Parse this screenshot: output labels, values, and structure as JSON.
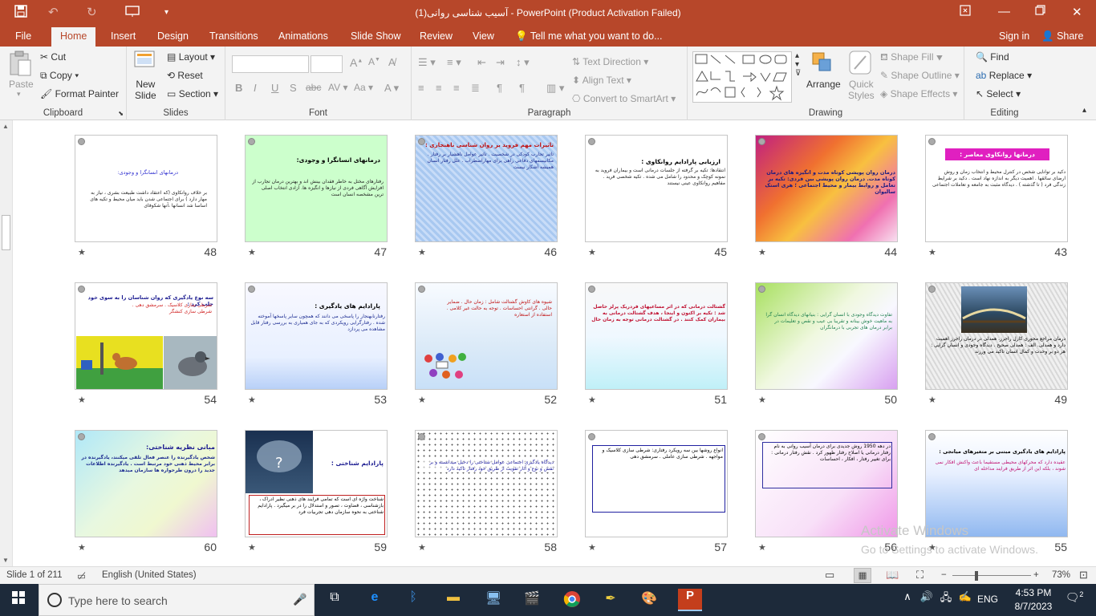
{
  "window": {
    "title": "آسیب شناسی روانی(1) - PowerPoint (Product Activation Failed)",
    "controls": [
      "restore-ribbon-icon",
      "minimize-icon",
      "maximize-icon",
      "close-icon"
    ]
  },
  "tabs": [
    "File",
    "Home",
    "Insert",
    "Design",
    "Transitions",
    "Animations",
    "Slide Show",
    "Review",
    "View"
  ],
  "active_tab": "Home",
  "tell_me": "Tell me what you want to do...",
  "account": {
    "signin": "Sign in",
    "share": "Share"
  },
  "ribbon": {
    "clipboard": {
      "label": "Clipboard",
      "paste": "Paste",
      "cut": "Cut",
      "copy": "Copy",
      "format_painter": "Format Painter"
    },
    "slides": {
      "label": "Slides",
      "new_slide": "New\nSlide",
      "layout": "Layout",
      "reset": "Reset",
      "section": "Section"
    },
    "font": {
      "label": "Font"
    },
    "paragraph": {
      "label": "Paragraph",
      "text_direction": "Text Direction",
      "align_text": "Align Text",
      "convert_smartart": "Convert to SmartArt"
    },
    "drawing": {
      "label": "Drawing",
      "arrange": "Arrange",
      "quick_styles": "Quick\nStyles",
      "shape_fill": "Shape Fill",
      "shape_outline": "Shape Outline",
      "shape_effects": "Shape Effects"
    },
    "editing": {
      "label": "Editing",
      "find": "Find",
      "replace": "Replace",
      "select": "Select"
    }
  },
  "slides": [
    {
      "n": "43",
      "heading": "درمانها روانکاوی معاصر :",
      "body": "دکید بر توانایی شخص در کنترل محیط و انتخاب زمان و روش ارضای سائقها . اهمیت دیگر به اندازه نهاد است . دکید بر شرایط زندگی فرد ( تا گذشته ) . دیدگاه مثبت به جامعه و تعاملات اجتماعی"
    },
    {
      "n": "44",
      "heading": "",
      "body": "درمان روان پویشی کوتاه مدت و انگیزه های درمان کوتاه مدت. درمان روان پویشی بین فردی: تکیه بر تعامل و روابط بیمار و محیط اجتماعی ؛ هری استک سالیوان"
    },
    {
      "n": "45",
      "heading": "ارزیابی پارادایم روانکاوی :",
      "body": "انتقادها: تکیه بر گرفته از جلسات درمانی است و بیماران فروید به نمونه کوچک و محدود را شامل می شده . تکیه شخصی فرید . مفاهیم روانکاوی عینی نیستند"
    },
    {
      "n": "46",
      "heading": "تاثیرات مهم فروید بر روان شناسی ناهنجاری :",
      "body": "تاثیر تجارب کودکی در شخصیت . تاثیر عوامل ناهشیار بر رفتار . مکانیسمهای دفاعی راهی برای مهاراضطراب . علل رفتار انسان همیشه آشکار نیست"
    },
    {
      "n": "47",
      "heading": "درمانهای انسانگرا و وجودی:",
      "body": "رفتارهای مختل به خاطر فقدان بینش اند و بهترین درمان تجارب از افزایش آگاهی فردی از نیازها و انگیزه ها. آزادی انتخاب اصلی ترین مشخصه انسان است"
    },
    {
      "n": "48",
      "heading": "درمانهای انسانگرا و وجودی:",
      "body": "بر خلاف روانکاوی (که اعتقاد داشت طبیعت بشری ، نیاز به مهار دارد ) برای اجتماعی شدن باید میان محیط و تکیه های اساسا شد انسانها ،آنها شکوفای"
    },
    {
      "n": "49",
      "heading": "",
      "body": "درمان مراجع محوری کارل راجرز. همدلی در درمان راجرز اهمیت دارد و همدلی. الف : همدلی صحیح . دیدگاه وجودی و انسان گرایی : هر دو بر وحدت و کمال انسان تاکید می ورزند"
    },
    {
      "n": "50",
      "heading": "",
      "body": "تفاوت دیدگاه وجودی با انسان گرایی : بنیانهای دیدگاه انسان گرا به ماهیت خوش بینانه و تقریبا بی عیب و نقص و تعلیمات در برابر درمان های تجربی با درمانگران"
    },
    {
      "n": "51",
      "heading": "",
      "body": "گشتالت درمانی که در اثر مساعیهای فردریک پرلز حاصل شد : تکیه بر اکنون و اینجا ، هدف گشتالت درمانی به بیماران کمک کنند . در گشتالت درمانی توجه به زمان حال"
    },
    {
      "n": "52",
      "heading": "",
      "body": "شیوه های کاوش گشتالت شامل : زمان حال . ضمایر حالی . گرانتی احساسات . توجه به حالت غیر کلامی . استفاده از استعاره"
    },
    {
      "n": "53",
      "heading": "پارادایم های یادگیری :",
      "body": "رفتارنابهنجار را پاسخی می دانند که همچون سایر پاسخها آموخته شده . رفتارگرایی رویکردی که به جای همیاری به بررسی رفتار قابل مشاهده می پردازد"
    },
    {
      "n": "54",
      "heading": "سه نوع یادگیری که روان شناسان را به سوی خود جلب کرد :",
      "body": "شرطی سازی کلاسیک . سرمشق دهی . شرطی سازی کنشگر"
    },
    {
      "n": "55",
      "heading": "پارادایم های یادگیری مبتنی بر متغیرهای میانجی :",
      "body": "عقیده دارد که محرکهای محیطی مستقیما باعث واکنش افکار نمی شوند ، بلکه این اثر از طریق فرایند مداخله ای"
    },
    {
      "n": "56",
      "heading": "",
      "body": "در دهه 1950 روش جدیدی برای درمان آسیب روانی به نام رفتار درمانی یا اصلاح رفتار ظهور کرد . نقش رفتار درمانی : برای تغییر رفتار ، افکار ، احساسات"
    },
    {
      "n": "57",
      "heading": "",
      "body": "انواع روشها بین سه رویکرد رفتاری: شرطی سازی کلاسیک و مواجهه . شرطی سازی عاملی . سرمشق دهی"
    },
    {
      "n": "58",
      "heading": "",
      "body": "دیدگاه یادگیری اجتماعی عوامل شناختی را دخیل میدانسته و بر نقش و نوع و آثار تقویت از طریق خود رفتار تاکید دارد"
    },
    {
      "n": "59",
      "heading": "پارادایم شناختی :",
      "body": "شناخت واژه ای است که تمامی فرایند های ذهنی نظیر ادراک ، بازشناسی ، قضاوت ، تصور و استدلال را در بر میگیرد . پارادایم شناختی به نحوه سازمان دهی تجربیات فرد"
    },
    {
      "n": "60",
      "heading": "مبانی نظریه شناختی:",
      "body": "شخص یادگیرنده را عنصر فعال تلقی میکنند، یادگیرنده در برابر محیط ذهنی خود مرتبط است . یادگیرنده اطلاعات جدید را درون طرحواره ها سازمان میدهد"
    }
  ],
  "status": {
    "slide": "Slide 1 of 211",
    "language": "English (United States)",
    "zoom": "73%"
  },
  "activation": {
    "line1": "Activate Windows",
    "line2": "Go to Settings to activate Windows."
  },
  "taskbar": {
    "search_placeholder": "Type here to search",
    "time": "4:53 PM",
    "date": "8/7/2023",
    "lang": "ENG",
    "notifications": "2"
  }
}
